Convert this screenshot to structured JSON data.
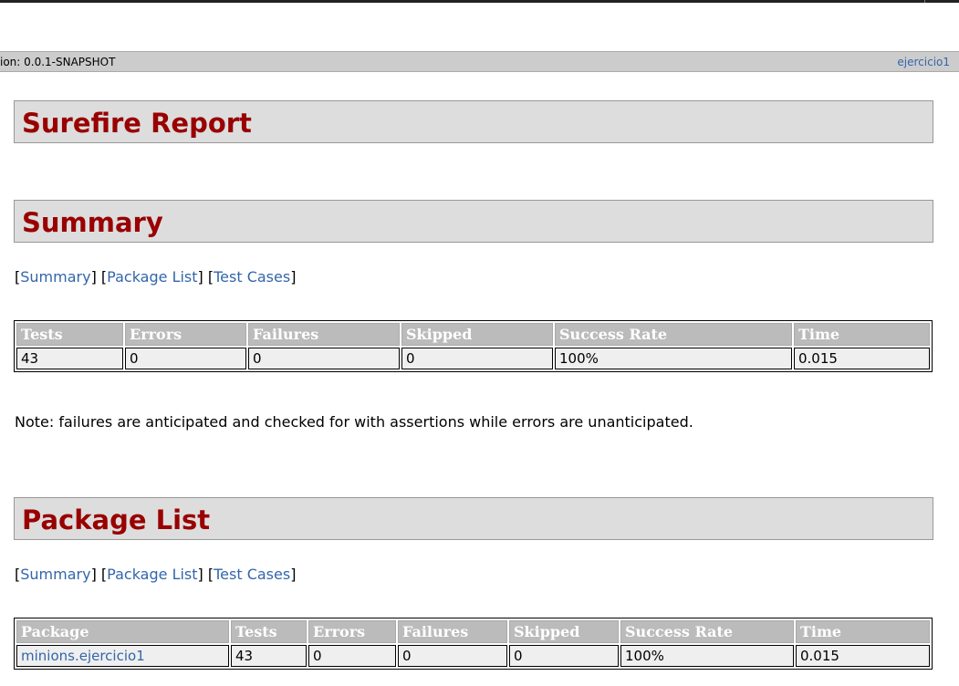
{
  "version_bar": {
    "version_text": "ion: 0.0.1-SNAPSHOT",
    "project_link": "ejercicio1"
  },
  "report": {
    "title": "Surefire Report"
  },
  "summary": {
    "title": "Summary",
    "nav": {
      "summary": "Summary",
      "package_list": "Package List",
      "test_cases": "Test Cases"
    },
    "table": {
      "headers": [
        "Tests",
        "Errors",
        "Failures",
        "Skipped",
        "Success Rate",
        "Time"
      ],
      "row": [
        "43",
        "0",
        "0",
        "0",
        "100%",
        "0.015"
      ]
    },
    "note": "Note: failures are anticipated and checked for with assertions while errors are unanticipated."
  },
  "package_list": {
    "title": "Package List",
    "nav": {
      "summary": "Summary",
      "package_list": "Package List",
      "test_cases": "Test Cases"
    },
    "table": {
      "headers": [
        "Package",
        "Tests",
        "Errors",
        "Failures",
        "Skipped",
        "Success Rate",
        "Time"
      ],
      "row": {
        "package": "minions.ejercicio1",
        "values": [
          "43",
          "0",
          "0",
          "0",
          "100%",
          "0.015"
        ]
      }
    }
  }
}
